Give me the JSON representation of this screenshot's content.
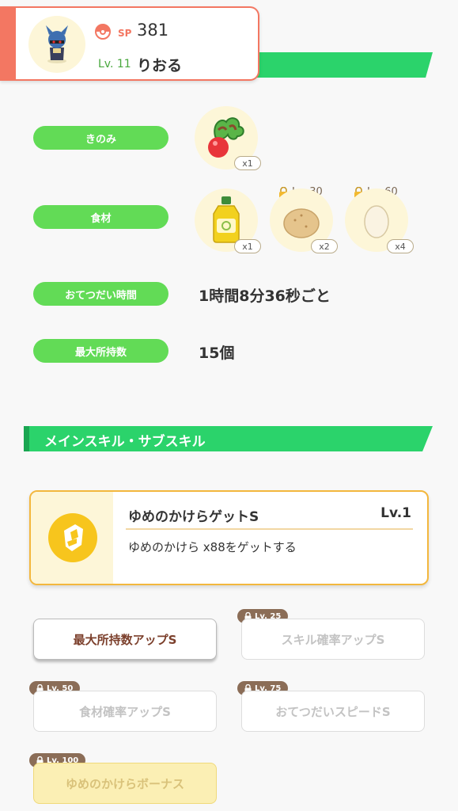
{
  "header": {
    "sp_label": "SP",
    "sp_value": "381",
    "level": "Lv. 11",
    "name": "りおる"
  },
  "rows": {
    "berry": {
      "label": "きのみ",
      "qty": "x1"
    },
    "ingredients": {
      "label": "食材",
      "items": [
        {
          "name": "oil-icon",
          "qty": "x1",
          "lock": ""
        },
        {
          "name": "potato-icon",
          "qty": "x2",
          "lock": "Lv. 30"
        },
        {
          "name": "egg-icon",
          "qty": "x4",
          "lock": "Lv. 60"
        }
      ]
    },
    "help_time": {
      "label": "おてつだい時間",
      "value": "1時間8分36秒ごと"
    },
    "max_carry": {
      "label": "最大所持数",
      "value": "15個"
    }
  },
  "skills_section": {
    "title": "メインスキル・サブスキル",
    "main": {
      "name": "ゆめのかけらゲットS",
      "level": "Lv.1",
      "description": "ゆめのかけら x88をゲットする"
    },
    "subs": [
      {
        "label": "最大所持数アップS",
        "lock": ""
      },
      {
        "label": "スキル確率アップS",
        "lock": "Lv. 25"
      },
      {
        "label": "食材確率アップS",
        "lock": "Lv. 50"
      },
      {
        "label": "おてつだいスピードS",
        "lock": "Lv. 75"
      },
      {
        "label": "ゆめのかけらボーナス",
        "lock": "Lv. 100"
      }
    ]
  },
  "colors": {
    "accent_green": "#2bd36b",
    "pill_green": "#62db56",
    "card_orange": "#f37762",
    "skill_gold": "#f3b73d"
  }
}
